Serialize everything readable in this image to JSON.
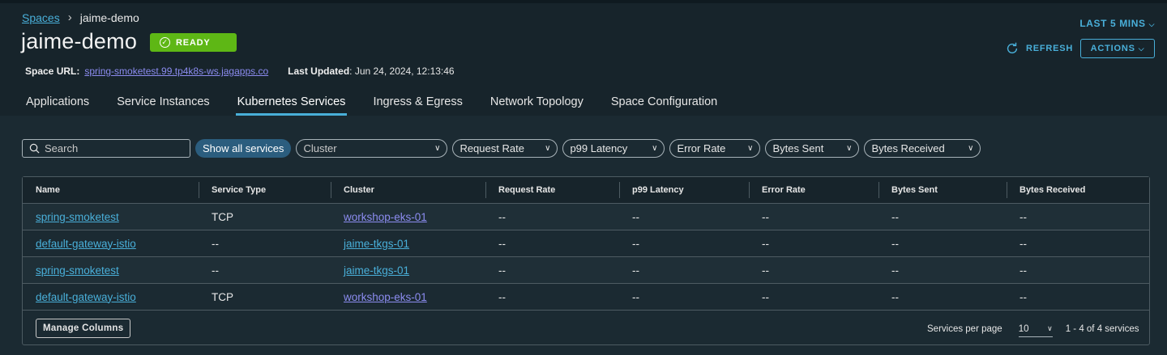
{
  "breadcrumb": {
    "root": "Spaces",
    "current": "jaime-demo"
  },
  "page": {
    "title": "jaime-demo",
    "status": "READY",
    "space_url_label": "Space URL:",
    "space_url": "spring-smoketest.99.tp4k8s-ws.jagapps.co",
    "last_updated_label": "Last Updated",
    "last_updated": ": Jun 24, 2024, 12:13:46"
  },
  "header_actions": {
    "time_range": "LAST 5 MINS",
    "refresh": "REFRESH",
    "actions": "ACTIONS"
  },
  "tabs": [
    {
      "label": "Applications",
      "active": false
    },
    {
      "label": "Service Instances",
      "active": false
    },
    {
      "label": "Kubernetes Services",
      "active": true
    },
    {
      "label": "Ingress & Egress",
      "active": false
    },
    {
      "label": "Network Topology",
      "active": false
    },
    {
      "label": "Space Configuration",
      "active": false
    }
  ],
  "filters": {
    "search_placeholder": "Search",
    "show_all": "Show all services",
    "cluster": "Cluster",
    "request_rate": "Request Rate",
    "p99_latency": "p99 Latency",
    "error_rate": "Error Rate",
    "bytes_sent": "Bytes Sent",
    "bytes_received": "Bytes Received"
  },
  "table": {
    "columns": [
      "Name",
      "Service Type",
      "Cluster",
      "Request Rate",
      "p99 Latency",
      "Error Rate",
      "Bytes Sent",
      "Bytes Received"
    ],
    "rows": [
      [
        "spring-smoketest",
        "TCP",
        "workshop-eks-01",
        "--",
        "--",
        "--",
        "--",
        "--"
      ],
      [
        "default-gateway-istio",
        "--",
        "jaime-tkgs-01",
        "--",
        "--",
        "--",
        "--",
        "--"
      ],
      [
        "spring-smoketest",
        "--",
        "jaime-tkgs-01",
        "--",
        "--",
        "--",
        "--",
        "--"
      ],
      [
        "default-gateway-istio",
        "TCP",
        "workshop-eks-01",
        "--",
        "--",
        "--",
        "--",
        "--"
      ]
    ]
  },
  "footer": {
    "manage_columns": "Manage Columns",
    "per_page_label": "Services per page",
    "per_page_value": "10",
    "range": "1 - 4 of 4 services"
  },
  "colors": {
    "accent": "#49afd9",
    "ready": "#5eb715",
    "link_visited": "#8c8cf0"
  }
}
